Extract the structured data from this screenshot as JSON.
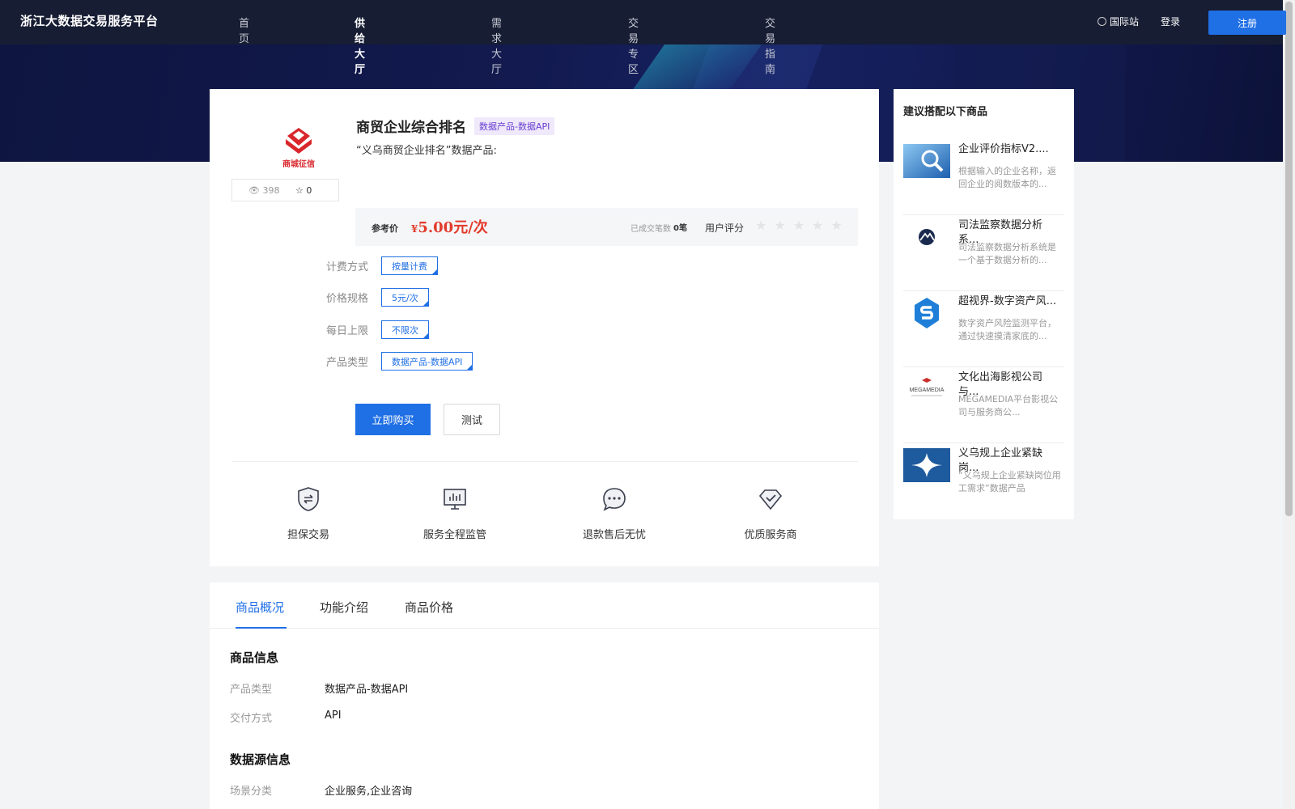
{
  "header": {
    "logo": "浙江大数据交易服务平台",
    "nav": [
      {
        "label": "首页",
        "active": false
      },
      {
        "label": "供给大厅",
        "active": true
      },
      {
        "label": "需求大厅",
        "active": false
      },
      {
        "label": "交易专区",
        "active": false
      },
      {
        "label": "交易指南",
        "active": false
      }
    ],
    "intl": "国际站",
    "login": "登录",
    "register": "注册"
  },
  "product": {
    "logo_text": "商城征信",
    "views": "398",
    "favorites": "0",
    "title": "商贸企业综合排名",
    "tag": "数据产品-数据API",
    "description": "“义乌商贸企业排名”数据产品:",
    "price_label": "参考价",
    "price_currency": "¥",
    "price_value": "5.00元/次",
    "deals_label": "已成交笔数",
    "deals_value": "0笔",
    "rating_label": "用户评分",
    "rating": 0,
    "specs": [
      {
        "label": "计费方式",
        "value": "按量计费"
      },
      {
        "label": "价格规格",
        "value": "5元/次"
      },
      {
        "label": "每日上限",
        "value": "不限次"
      },
      {
        "label": "产品类型",
        "value": "数据产品-数据API"
      }
    ],
    "buy_label": "立即购买",
    "test_label": "测试",
    "features": [
      {
        "label": "担保交易",
        "icon": "shield-exchange-icon"
      },
      {
        "label": "服务全程监管",
        "icon": "monitor-chart-icon"
      },
      {
        "label": "退款售后无忧",
        "icon": "chat-bubble-icon"
      },
      {
        "label": "优质服务商",
        "icon": "diamond-check-icon"
      }
    ]
  },
  "detail": {
    "tabs": [
      {
        "label": "商品概况",
        "active": true
      },
      {
        "label": "功能介绍",
        "active": false
      },
      {
        "label": "商品价格",
        "active": false
      }
    ],
    "sections": [
      {
        "title": "商品信息",
        "rows": [
          {
            "key": "产品类型",
            "value": "数据产品-数据API"
          },
          {
            "key": "交付方式",
            "value": "API"
          }
        ]
      },
      {
        "title": "数据源信息",
        "rows": [
          {
            "key": "场景分类",
            "value": "企业服务,企业咨询"
          }
        ]
      }
    ]
  },
  "sidebar": {
    "title": "建议搭配以下商品",
    "items": [
      {
        "title": "企业评价指标V2....",
        "desc": "根据输入的企业名称，返回企业的阅数版本的...",
        "thumb": "magnifier-data-image"
      },
      {
        "title": "司法监察数据分析系...",
        "desc": "司法监察数据分析系统是一个基于数据分析的...",
        "thumb": "mountain-logo-image"
      },
      {
        "title": "超视界-数字资产风...",
        "desc": "数字资产风险监测平台，通过快速摸清家底的...",
        "thumb": "shield-s-logo-image"
      },
      {
        "title": "文化出海影视公司与...",
        "desc": "MEGAMEDIA平台影视公司与服务商公...",
        "thumb": "megamedia-logo-image",
        "thumb_text": "MEGAMEDIA"
      },
      {
        "title": "义乌规上企业紧缺岗...",
        "desc": "“义乌规上企业紧缺岗位用工需求”数据产品",
        "thumb": "blue-star-logo-image"
      }
    ]
  },
  "colors": {
    "primary": "#1f6fe5",
    "header_bg": "#171d33",
    "price": "#e23b2b",
    "tag_bg": "#efe9fb",
    "tag_text": "#6a3fd0"
  }
}
